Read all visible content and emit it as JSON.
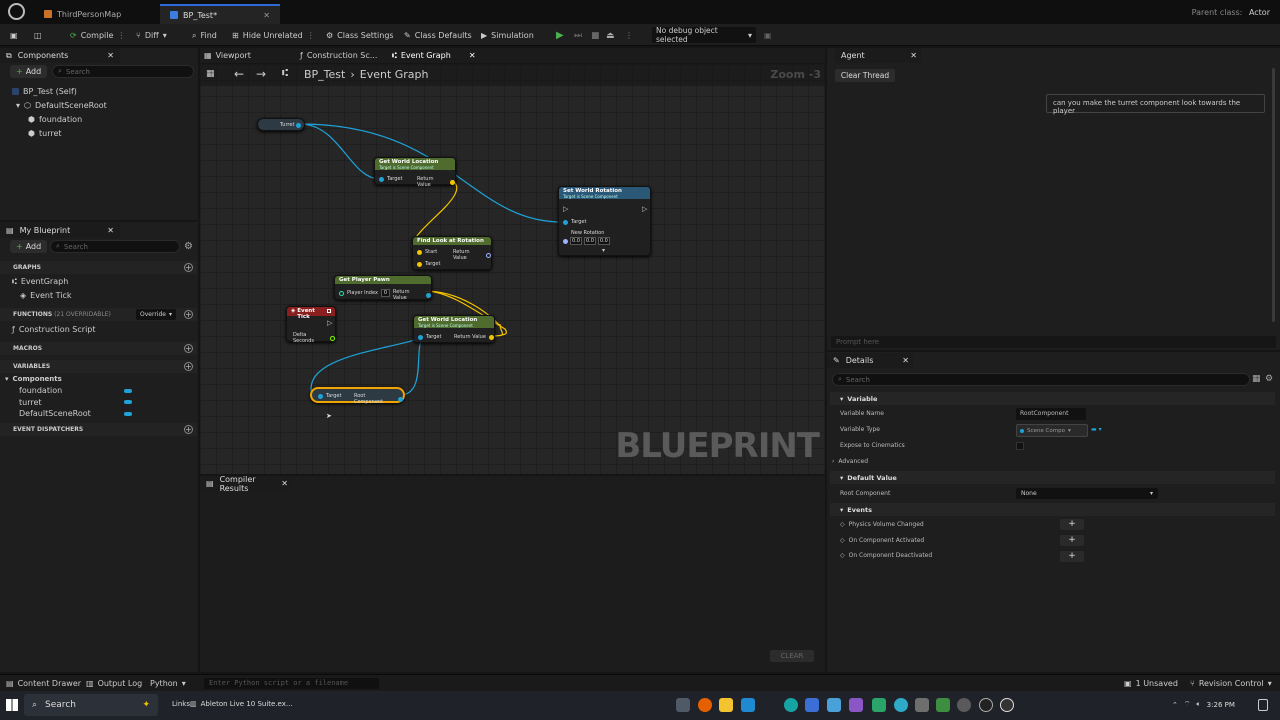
{
  "titlebar": {
    "tabs": [
      {
        "label": "ThirdPersonMap"
      },
      {
        "label": "BP_Test*"
      }
    ],
    "parent_class_label": "Parent class:",
    "parent_class_value": "Actor"
  },
  "toolbar": {
    "compile": "Compile",
    "diff": "Diff",
    "find": "Find",
    "hide_unrelated": "Hide Unrelated",
    "class_settings": "Class Settings",
    "class_defaults": "Class Defaults",
    "simulation": "Simulation",
    "debug_object": "No debug object selected"
  },
  "components": {
    "title": "Components",
    "add": "Add",
    "search_placeholder": "Search",
    "tree": [
      "BP_Test (Self)",
      "DefaultSceneRoot",
      "foundation",
      "turret"
    ]
  },
  "my_blueprint": {
    "title": "My Blueprint",
    "add": "Add",
    "search_placeholder": "Search",
    "graphs_header": "GRAPHS",
    "event_graph": "EventGraph",
    "event_tick": "Event Tick",
    "functions_header": "FUNCTIONS",
    "functions_count": "(21 OVERRIDABLE)",
    "override": "Override",
    "construction_script": "Construction Script",
    "macros_header": "MACROS",
    "variables_header": "VARIABLES",
    "components_group": "Components",
    "variables": [
      "foundation",
      "turret",
      "DefaultSceneRoot"
    ],
    "dispatchers_header": "EVENT DISPATCHERS"
  },
  "graph": {
    "tabs": [
      {
        "label": "Viewport"
      },
      {
        "label": "Construction Sc..."
      },
      {
        "label": "Event Graph"
      }
    ],
    "breadcrumb_root": "BP_Test",
    "breadcrumb_leaf": "Event Graph",
    "zoom": "Zoom -3",
    "watermark": "BLUEPRINT",
    "nodes": {
      "turret": "Turret",
      "gwl1_title": "Get World Location",
      "gwl1_sub": "Target is Scene Component",
      "gwl1_target": "Target",
      "gwl1_return": "Return Value",
      "swr_title": "Set World Rotation",
      "swr_sub": "Target is Scene Component",
      "swr_target": "Target",
      "swr_newrot": "New Rotation",
      "swr_x": "0.0",
      "swr_y": "0.0",
      "swr_z": "0.0",
      "flr_title": "Find Look at Rotation",
      "flr_start": "Start",
      "flr_target": "Target",
      "flr_return": "Return Value",
      "gpp_title": "Get Player Pawn",
      "gpp_index": "Player Index",
      "gpp_index_val": "0",
      "gpp_return": "Return Value",
      "tick_title": "Event Tick",
      "tick_delta": "Delta Seconds",
      "gwl2_title": "Get World Location",
      "gwl2_sub": "Target is Scene Component",
      "gwl2_target": "Target",
      "gwl2_return": "Return Value",
      "root_target": "Target",
      "root_label": "Root Component"
    }
  },
  "compiler": {
    "title": "Compiler Results",
    "clear": "CLEAR"
  },
  "agent": {
    "title": "Agent",
    "clear_thread": "Clear Thread",
    "message": "can you make the turret component look towards the player",
    "prompt_placeholder": "Prompt here"
  },
  "details": {
    "title": "Details",
    "search_placeholder": "Search",
    "variable_section": "Variable",
    "variable_name_label": "Variable Name",
    "variable_name_value": "RootComponent",
    "variable_type_label": "Variable Type",
    "variable_type_value": "Scene Compo",
    "expose_label": "Expose to Cinematics",
    "advanced": "Advanced",
    "default_section": "Default Value",
    "root_component_label": "Root Component",
    "root_component_value": "None",
    "events_section": "Events",
    "events": [
      "Physics Volume Changed",
      "On Component Activated",
      "On Component Deactivated"
    ]
  },
  "statusbar": {
    "content_drawer": "Content Drawer",
    "output_log": "Output Log",
    "python": "Python",
    "cmd_placeholder": "Enter Python script or a filename",
    "unsaved": "1 Unsaved",
    "revision_control": "Revision Control"
  },
  "taskbar": {
    "search": "Search",
    "links": "Links",
    "ableton": "Ableton Live 10 Suite.ex...",
    "time": "3:26 PM"
  },
  "colors": {
    "accent": "#2f6bd8",
    "exec_pin": "#ffffff",
    "object_pin": "#1ea2d8",
    "vector_pin": "#f4c400",
    "rotator_pin": "#9db3ff",
    "func_header_green": "#4f6b2e",
    "func_header_blue": "#2c5878",
    "event_header_red": "#8a1f1f"
  }
}
